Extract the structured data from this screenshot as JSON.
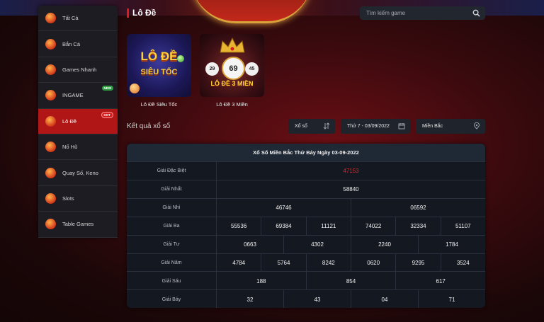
{
  "sidebar": {
    "items": [
      {
        "label": "Tất Cả",
        "badge": ""
      },
      {
        "label": "Bắn Cá",
        "badge": ""
      },
      {
        "label": "Games Nhanh",
        "badge": ""
      },
      {
        "label": "INGAME",
        "badge": "NEW"
      },
      {
        "label": "Lô Đề",
        "badge": "HOT"
      },
      {
        "label": "Nổ Hũ",
        "badge": ""
      },
      {
        "label": "Quay Số, Keno",
        "badge": ""
      },
      {
        "label": "Slots",
        "badge": ""
      },
      {
        "label": "Table Games",
        "badge": ""
      }
    ],
    "active_index": 4
  },
  "header": {
    "title": "Lô Đề",
    "search_placeholder": "Tìm kiếm game"
  },
  "games": [
    {
      "label": "Lô Đề Siêu Tốc",
      "art_line1": "LÔ ĐỀ",
      "art_line2": "SIÊU TỐC"
    },
    {
      "label": "Lô Đề 3 Miền",
      "art_line1": "LÔ ĐỀ 3 MIỀN",
      "balls": [
        "29",
        "69",
        "45"
      ]
    }
  ],
  "results": {
    "section_title": "Kết quả xổ số",
    "filters": {
      "type": "Xổ số",
      "date": "Thứ 7 - 03/09/2022",
      "region": "Miền Bắc"
    },
    "table_title": "Xổ Số Miền Bắc Thứ Bảy Ngày 03-09-2022",
    "rows": [
      {
        "label": "Giải Đặc Biệt",
        "values": [
          "47153"
        ],
        "special": true
      },
      {
        "label": "Giải Nhất",
        "values": [
          "58840"
        ]
      },
      {
        "label": "Giải Nhì",
        "values": [
          "46746",
          "06592"
        ]
      },
      {
        "label": "Giải Ba",
        "values": [
          "55536",
          "69384",
          "11121",
          "74022",
          "32334",
          "51107"
        ]
      },
      {
        "label": "Giải Tư",
        "values": [
          "0663",
          "4302",
          "2240",
          "1784"
        ]
      },
      {
        "label": "Giải Năm",
        "values": [
          "4784",
          "5764",
          "8242",
          "0620",
          "9295",
          "3524"
        ]
      },
      {
        "label": "Giải Sáu",
        "values": [
          "188",
          "854",
          "617"
        ]
      },
      {
        "label": "Giải Bảy",
        "values": [
          "32",
          "43",
          "04",
          "71"
        ]
      }
    ]
  },
  "colors": {
    "accent": "#b01616",
    "special_prize": "#e02828"
  }
}
